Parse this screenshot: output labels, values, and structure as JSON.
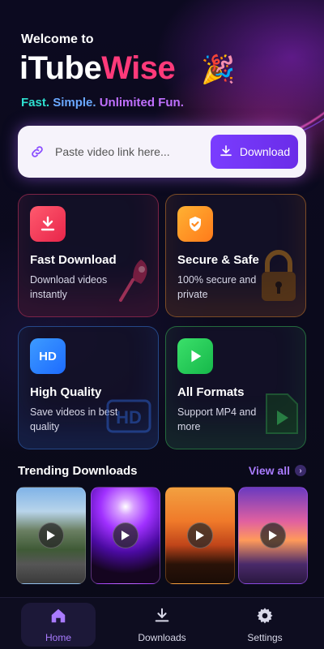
{
  "hero": {
    "welcome": "Welcome to",
    "brand_part1": "iTube",
    "brand_part2": "Wise",
    "tagline": [
      "Fast.",
      "Simple.",
      "Unlimited Fun."
    ]
  },
  "search": {
    "placeholder": "Paste video link here...",
    "button_label": "Download"
  },
  "features": [
    {
      "title": "Fast Download",
      "desc": "Download videos instantly",
      "icon": "download-icon",
      "color": "#ff3a5a"
    },
    {
      "title": "Secure & Safe",
      "desc": "100% secure and private",
      "icon": "shield-icon",
      "color": "#ff9a1f"
    },
    {
      "title": "High Quality",
      "desc": "Save videos in best quality",
      "icon": "hd-icon",
      "icon_text": "HD",
      "color": "#2f85ff"
    },
    {
      "title": "All Formats",
      "desc": "Support MP4 and more",
      "icon": "play-icon",
      "color": "#2ad25a"
    }
  ],
  "trending": {
    "title": "Trending Downloads",
    "view_all": "View all",
    "items": [
      {
        "scene": "mountain-road"
      },
      {
        "scene": "concert"
      },
      {
        "scene": "sunset-palms"
      },
      {
        "scene": "hot-air-balloons"
      }
    ]
  },
  "nav": {
    "items": [
      {
        "label": "Home",
        "icon": "home-icon",
        "active": true
      },
      {
        "label": "Downloads",
        "icon": "download-icon",
        "active": false
      },
      {
        "label": "Settings",
        "icon": "gear-icon",
        "active": false
      }
    ]
  },
  "colors": {
    "accent": "#7a3dff",
    "brand_highlight": "#ff3a7a",
    "background": "#0b0a1c"
  }
}
